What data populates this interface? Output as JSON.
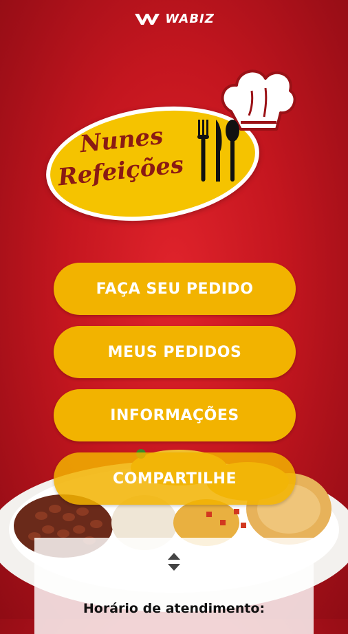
{
  "header": {
    "brand": "WABIZ",
    "brand_icon": "wabiz-logo-icon"
  },
  "logo": {
    "line1": "Nunes",
    "line2": "Refeições",
    "hat_icon": "chef-hat-icon",
    "cutlery_icon": "cutlery-icon"
  },
  "menu": {
    "buttons": [
      {
        "label": "FAÇA SEU PEDIDO"
      },
      {
        "label": "MEUS PEDIDOS"
      },
      {
        "label": "INFORMAÇÕES"
      },
      {
        "label": "COMPARTILHE"
      }
    ]
  },
  "hours": {
    "toggle_icon": "expand-collapse-icon",
    "title": "Horário de atendimento:"
  },
  "colors": {
    "background": "#c4161f",
    "button": "#f2b300",
    "logo_yellow": "#f5c300",
    "logo_text": "#8a1a14"
  }
}
